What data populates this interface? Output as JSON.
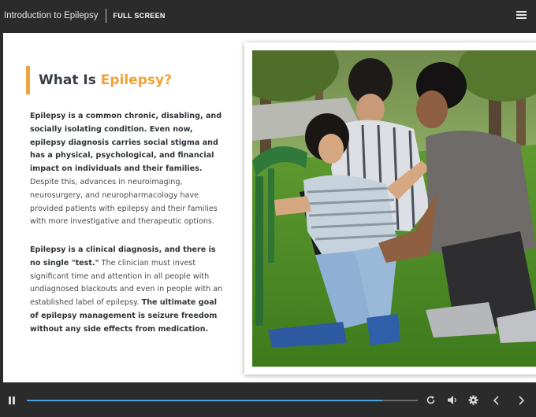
{
  "header": {
    "course_title": "Introduction to Epilepsy",
    "fullscreen_label": "FULL SCREEN",
    "menu_icon": "hamburger-menu-icon"
  },
  "slide": {
    "heading_prefix": "What Is ",
    "heading_accent": "Epilepsy?",
    "accent_color": "#f0a23b",
    "paragraph1": {
      "bold": "Epilepsy is a common chronic, disabling, and socially isolating condition. Even now, epilepsy diagnosis carries social stigma and has a physical, psychological, and financial impact on individuals and their families.",
      "regular": " Despite this, advances in neuroimaging, neurosurgery, and neuropharmacology have provided patients with epilepsy and their families with more investigative and therapeutic options."
    },
    "paragraph2": {
      "bold1": "Epilepsy is a clinical diagnosis, and there is no single \"test.\"",
      "regular": " The clinician must invest significant time and attention in all people with undiagnosed blackouts and even in people with an established label of epilepsy.",
      "bold2": " The ultimate goal of epilepsy management is seizure freedom without any side effects from medication."
    },
    "image_icon": "photo-child-seizure-park"
  },
  "player": {
    "progress_fraction": 0.91,
    "progress_color": "#4aa3e0",
    "icons": [
      "pause-icon",
      "replay-icon",
      "volume-icon",
      "settings-icon",
      "previous-icon",
      "next-icon"
    ]
  }
}
